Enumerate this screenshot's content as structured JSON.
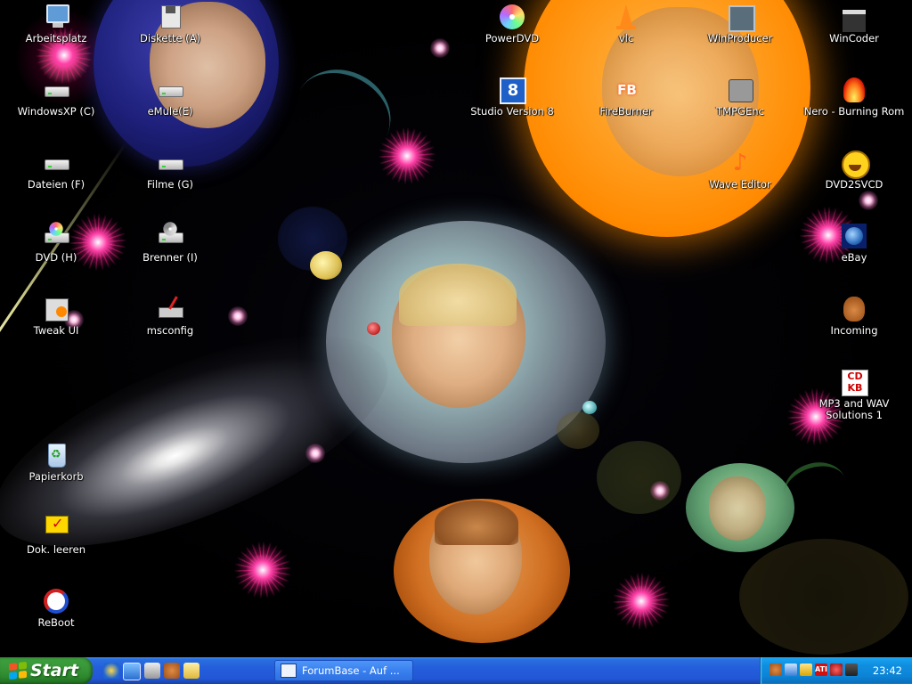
{
  "desktop": {
    "icons": [
      {
        "label": "Arbeitsplatz",
        "icon": "my-computer-icon"
      },
      {
        "label": "Diskette (A)",
        "icon": "floppy-drive-icon"
      },
      {
        "label": "WindowsXP (C)",
        "icon": "hard-drive-icon"
      },
      {
        "label": "eMule(E)",
        "icon": "hard-drive-icon"
      },
      {
        "label": "Dateien (F)",
        "icon": "hard-drive-icon"
      },
      {
        "label": "Filme (G)",
        "icon": "hard-drive-icon"
      },
      {
        "label": "DVD (H)",
        "icon": "dvd-drive-icon"
      },
      {
        "label": "Brenner (I)",
        "icon": "cd-drive-icon"
      },
      {
        "label": "Tweak UI",
        "icon": "tweak-ui-icon"
      },
      {
        "label": "msconfig",
        "icon": "msconfig-icon"
      },
      {
        "label": "Papierkorb",
        "icon": "recycle-bin-icon"
      },
      {
        "label": "Dok. leeren",
        "icon": "clear-documents-icon"
      },
      {
        "label": "ReBoot",
        "icon": "reboot-icon"
      },
      {
        "label": "PowerDVD",
        "icon": "powerdvd-icon"
      },
      {
        "label": "vlc",
        "icon": "vlc-cone-icon"
      },
      {
        "label": "WinProducer",
        "icon": "winproducer-icon"
      },
      {
        "label": "WinCoder",
        "icon": "wincoder-icon"
      },
      {
        "label": "Studio Version 8",
        "icon": "studio-icon"
      },
      {
        "label": "FireBurner",
        "icon": "fireburner-icon"
      },
      {
        "label": "TMPGEnc",
        "icon": "tmpgenc-icon"
      },
      {
        "label": "Nero - Burning Rom",
        "icon": "nero-icon"
      },
      {
        "label": "Wave Editor",
        "icon": "wave-editor-icon"
      },
      {
        "label": "DVD2SVCD",
        "icon": "dvd2svcd-icon"
      },
      {
        "label": "eBay",
        "icon": "ebay-icon"
      },
      {
        "label": "Incoming",
        "icon": "incoming-icon"
      },
      {
        "label": "MP3 and WAV Solutions 1",
        "icon": "mp3-wav-icon"
      }
    ]
  },
  "taskbar": {
    "start_label": "Start",
    "quick_launch": [
      "ie-icon",
      "desktop-icon",
      "media-icon",
      "mule-icon",
      "folder-icon"
    ],
    "task_item": {
      "label": "ForumBase - Auf ...",
      "icon": "browser-window-icon"
    },
    "tray_icons": [
      "tray-donkey-icon",
      "tray-network-icon",
      "tray-printer-icon",
      "tray-ati-icon",
      "tray-sync-icon",
      "tray-camera-icon"
    ],
    "clock": "23:42"
  },
  "colors": {
    "taskbar_blue": "#245edb",
    "start_green": "#3a9a3a",
    "tray_blue": "#0f8ee0"
  }
}
